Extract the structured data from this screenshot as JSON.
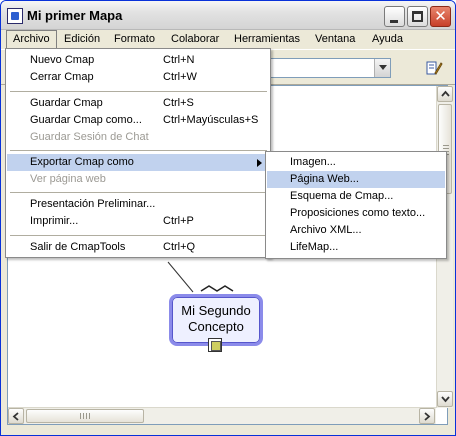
{
  "window": {
    "title": "Mi primer Mapa"
  },
  "menubar": [
    "Archivo",
    "Edición",
    "Formato",
    "Colaborar",
    "Herramientas",
    "Ventana",
    "Ayuda"
  ],
  "archivo_menu": [
    {
      "label": "Nuevo Cmap",
      "shortcut": "Ctrl+N",
      "enabled": true
    },
    {
      "label": "Cerrar Cmap",
      "shortcut": "Ctrl+W",
      "enabled": true
    },
    {
      "label": "Guardar Cmap",
      "shortcut": "Ctrl+S",
      "enabled": true
    },
    {
      "label": "Guardar Cmap como...",
      "shortcut": "Ctrl+Mayúsculas+S",
      "enabled": true
    },
    {
      "label": "Guardar Sesión de Chat",
      "shortcut": "",
      "enabled": false
    },
    {
      "label": "Exportar Cmap como",
      "shortcut": "",
      "enabled": true,
      "submenu": true,
      "highlighted": true
    },
    {
      "label": "Ver página web",
      "shortcut": "",
      "enabled": false
    },
    {
      "label": "Presentación Preliminar...",
      "shortcut": "",
      "enabled": true
    },
    {
      "label": "Imprimir...",
      "shortcut": "Ctrl+P",
      "enabled": true
    },
    {
      "label": "Salir de CmapTools",
      "shortcut": "Ctrl+Q",
      "enabled": true
    }
  ],
  "export_submenu": [
    "Imagen...",
    "Página Web...",
    "Esquema de Cmap...",
    "Proposiciones como texto...",
    "Archivo XML...",
    "LifeMap..."
  ],
  "export_highlighted": "Página Web...",
  "concept": {
    "text_line1": "Mi Segundo",
    "text_line2": "Concepto"
  },
  "icons": [
    "app-icon",
    "minimize-icon",
    "maximize-icon",
    "close-icon",
    "dropdown-arrow-icon",
    "styles-palette-icon",
    "resource-icon",
    "scroll-arrow-icons"
  ],
  "colors": {
    "highlight": "#c1d2ee",
    "concept_border": "#8b8bea",
    "concept_fill": "#eef0ff"
  }
}
